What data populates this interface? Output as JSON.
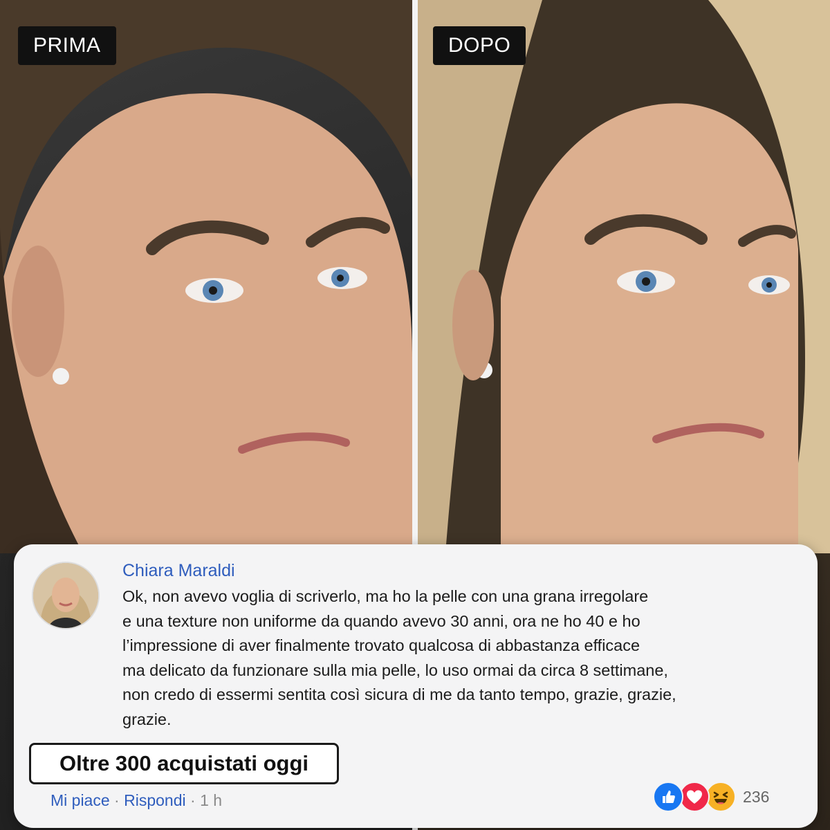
{
  "labels": {
    "before": "PRIMA",
    "after": "DOPO"
  },
  "comment": {
    "author": "Chiara Maraldi",
    "lines": [
      "Ok, non avevo voglia di scriverlo, ma ho la pelle con una grana irregolare",
      "e una texture non uniforme da quando avevo 30 anni, ora ne ho 40 e ho",
      "l’impressione di aver finalmente trovato qualcosa di abbastanza efficace",
      "ma delicato da funzionare sulla mia pelle, lo uso ormai da circa 8 settimane,",
      "non credo di essermi sentita così sicura di me da tanto tempo, grazie, grazie,",
      "grazie."
    ],
    "like_label": "Mi piace",
    "reply_label": "Rispondi",
    "separator": "·",
    "time": "1 h",
    "reaction_count": "236"
  },
  "badge": {
    "label": "Oltre 300 acquistati oggi"
  },
  "icons": [
    "like-icon",
    "love-icon",
    "haha-icon"
  ],
  "colors": {
    "author_link": "#2f5dbd",
    "like": "#1877f2",
    "love": "#f02849",
    "haha": "#f7b125"
  }
}
